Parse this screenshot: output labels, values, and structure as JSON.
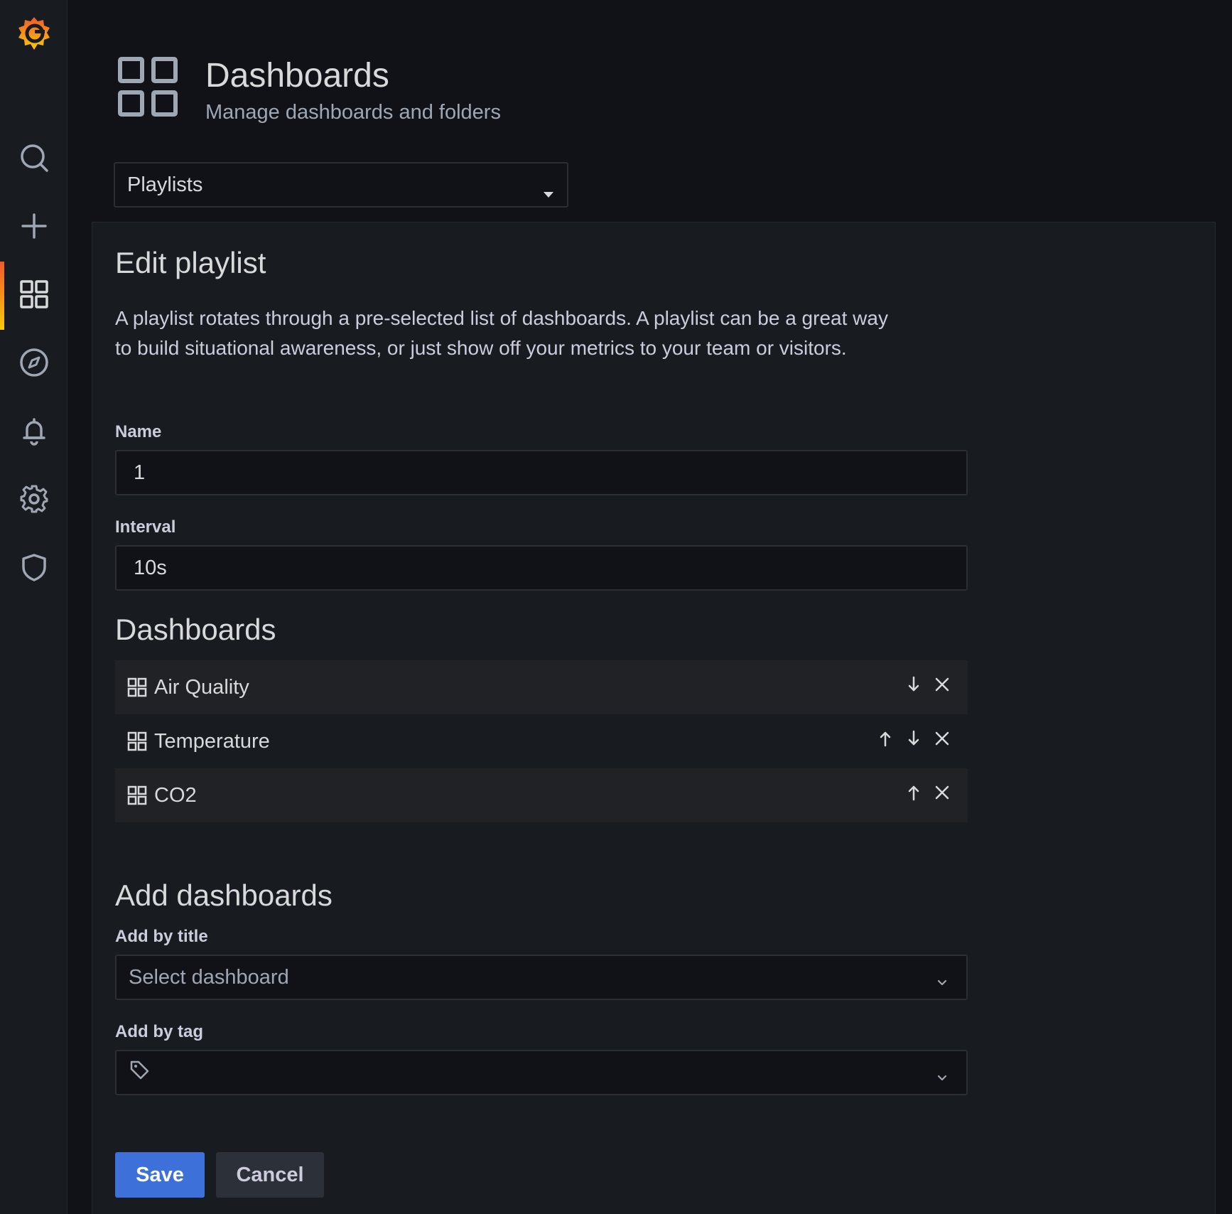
{
  "sidebar": {
    "items": [
      {
        "name": "search",
        "icon": "search-icon"
      },
      {
        "name": "create",
        "icon": "plus-icon"
      },
      {
        "name": "dashboards",
        "icon": "apps-icon",
        "active": true
      },
      {
        "name": "explore",
        "icon": "compass-icon"
      },
      {
        "name": "alerting",
        "icon": "bell-icon"
      },
      {
        "name": "configuration",
        "icon": "cog-icon"
      },
      {
        "name": "server-admin",
        "icon": "shield-icon"
      }
    ],
    "accent": "#f05a28"
  },
  "header": {
    "title": "Dashboards",
    "subtitle": "Manage dashboards and folders",
    "section_select": "Playlists"
  },
  "form": {
    "title": "Edit playlist",
    "description": "A playlist rotates through a pre-selected list of dashboards. A playlist can be a great way to build situational awareness, or just show off your metrics to your team or visitors.",
    "name_label": "Name",
    "name_value": "1",
    "interval_label": "Interval",
    "interval_value": "10s",
    "dashboards_heading": "Dashboards",
    "dashboards": [
      {
        "title": "Air Quality",
        "up": false,
        "down": true
      },
      {
        "title": "Temperature",
        "up": true,
        "down": true
      },
      {
        "title": "CO2",
        "up": true,
        "down": false
      }
    ],
    "add_heading": "Add dashboards",
    "add_by_title_label": "Add by title",
    "add_by_title_placeholder": "Select dashboard",
    "add_by_tag_label": "Add by tag",
    "save_label": "Save",
    "cancel_label": "Cancel"
  },
  "colors": {
    "background": "#111217",
    "panel": "#181b1f",
    "primary_button": "#3d71d9"
  }
}
